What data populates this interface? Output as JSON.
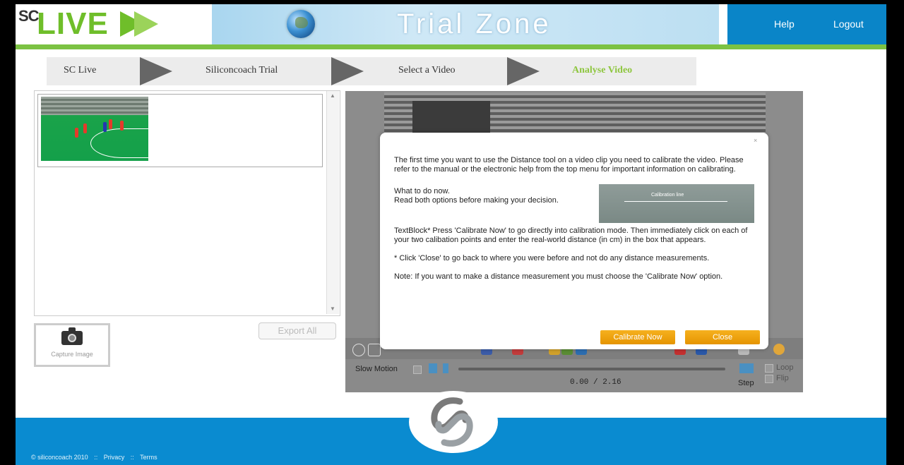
{
  "header": {
    "logo_prefix": "SC",
    "logo_word": "LIVE",
    "title": "Trial Zone",
    "nav": {
      "help": "Help",
      "logout": "Logout"
    }
  },
  "breadcrumb": [
    "SC Live",
    "Siliconcoach Trial",
    "Select a Video",
    "Analyse Video"
  ],
  "left": {
    "capture_label": "Capture Image",
    "export_label": "Export All"
  },
  "dialog": {
    "close_glyph": "×",
    "intro": "The first time you want to use the Distance tool on a video clip you need to calibrate the video. Please refer to the manual or the electronic help from the top menu for important information on calibrating.",
    "what_to_do": "What to do now.",
    "read_both": "Read both options before making your decision.",
    "image_label": "Calibration line",
    "option1": "TextBlock* Press 'Calibrate Now' to go directly into calibration mode. Then immediately click on each of your two calibation points and enter the real-world distance (in cm) in the box that appears.",
    "option2": "* Click 'Close' to go back to where you were before and not do any distance measurements.",
    "note": "Note: If you want to make a distance measurement you must choose the 'Calibrate Now' option.",
    "calibrate_label": "Calibrate Now",
    "close_label": "Close"
  },
  "player": {
    "slow_motion": "Slow Motion",
    "time": "0.00 / 2.16",
    "step": "Step",
    "loop": "Loop",
    "flip": "Flip"
  },
  "footer": {
    "copyright": "© siliconcoach 2010",
    "sep1": "::",
    "privacy": "Privacy",
    "sep2": "::",
    "terms": "Terms"
  },
  "colors": {
    "brand_green": "#7cc243",
    "brand_blue": "#0a8bd0",
    "accent_orange": "#f0a10f"
  }
}
